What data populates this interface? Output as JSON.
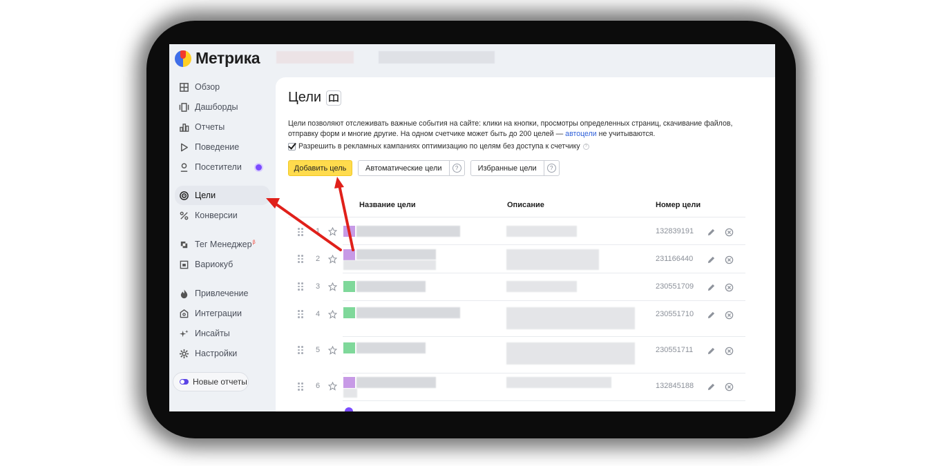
{
  "app": {
    "logo_text": "Метрика"
  },
  "sidebar": {
    "items": [
      {
        "label": "Обзор",
        "icon": "overview-icon"
      },
      {
        "label": "Дашборды",
        "icon": "dashboards-icon"
      },
      {
        "label": "Отчеты",
        "icon": "reports-icon"
      },
      {
        "label": "Поведение",
        "icon": "play-icon"
      },
      {
        "label": "Посетители",
        "icon": "user-icon"
      },
      {
        "label": "Цели",
        "icon": "target-icon",
        "active": true
      },
      {
        "label": "Конверсии",
        "icon": "percent-icon"
      },
      {
        "label": "Тег Менеджер",
        "icon": "tag-manager-icon",
        "badge": "β"
      },
      {
        "label": "Вариокуб",
        "icon": "variocube-icon"
      },
      {
        "label": "Привлечение",
        "icon": "flame-icon"
      },
      {
        "label": "Интеграции",
        "icon": "puzzle-icon"
      },
      {
        "label": "Инсайты",
        "icon": "sparkle-icon"
      },
      {
        "label": "Настройки",
        "icon": "gear-icon"
      }
    ],
    "new_reports_label": "Новые отчеты"
  },
  "main": {
    "title": "Цели",
    "description_part1": "Цели позволяют отслеживать важные события на сайте: клики на кнопки, просмотры определенных страниц, скачивание файлов, отправку форм и многие другие. На одном счетчике может быть до 200 целей — ",
    "description_link": "автоцели",
    "description_part2": " не учитываются.",
    "checkbox_label": "Разрешить в рекламных кампаниях оптимизацию по целям без доступа к счетчику",
    "checkbox_checked": true,
    "add_goal_button": "Добавить цель",
    "auto_goals_button": "Автоматические цели",
    "favorite_goals_button": "Избранные цели",
    "help_glyph": "?",
    "columns": {
      "name": "Название цели",
      "description": "Описание",
      "number": "Номер цели"
    },
    "rows": [
      {
        "index": "1",
        "id": "132839191",
        "color": "#c79ae6"
      },
      {
        "index": "2",
        "id": "231166440",
        "color": "#c79ae6"
      },
      {
        "index": "3",
        "id": "230551709",
        "color": "#7fd89a"
      },
      {
        "index": "4",
        "id": "230551710",
        "color": "#7fd89a"
      },
      {
        "index": "5",
        "id": "230551711",
        "color": "#7fd89a"
      },
      {
        "index": "6",
        "id": "132845188",
        "color": "#c79ae6"
      }
    ]
  },
  "colors": {
    "accent_yellow": "#ffdb4d",
    "annotation_red": "#e0201a",
    "link_blue": "#2d5fd9",
    "status_dot": "#7b4cff"
  }
}
